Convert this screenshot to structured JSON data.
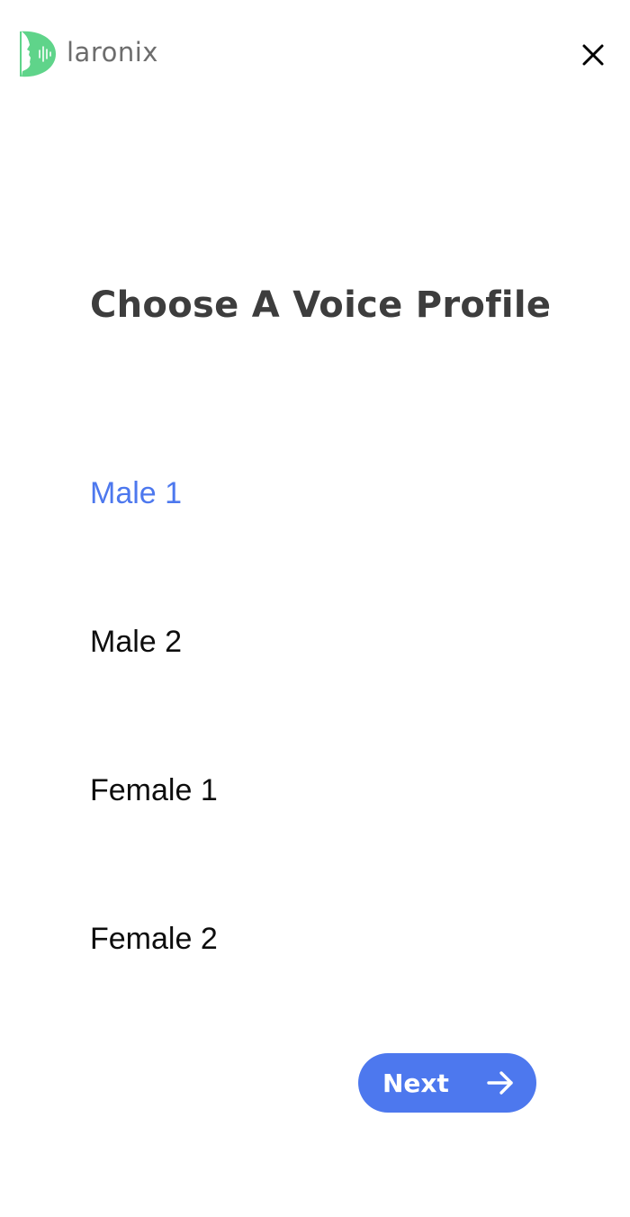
{
  "header": {
    "logo_text": "laronix",
    "logo_icon": "face-profile-soundwave-logo",
    "close_icon": "close-icon"
  },
  "main": {
    "title": "Choose A Voice Profile",
    "options": [
      {
        "label": "Male 1",
        "selected": true
      },
      {
        "label": "Male 2",
        "selected": false
      },
      {
        "label": "Female 1",
        "selected": false
      },
      {
        "label": "Female 2",
        "selected": false
      }
    ],
    "next_label": "Next",
    "next_icon": "arrow-right-icon"
  },
  "colors": {
    "accent": "#4d78ee",
    "logo_green": "#5fd48a",
    "title": "#3d3d3d",
    "text": "#0d0d0d",
    "logo_text": "#6d6d6d"
  }
}
